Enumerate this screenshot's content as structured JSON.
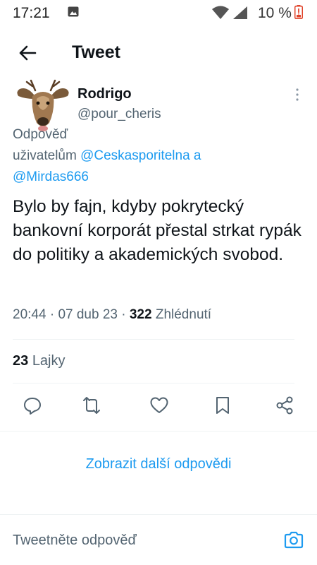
{
  "status_bar": {
    "time": "17:21",
    "battery": "10 %",
    "icons": [
      "image-icon",
      "wifi-icon",
      "cellular-icon",
      "battery-low-icon"
    ]
  },
  "header": {
    "back_icon": "arrow-left-icon",
    "title": "Tweet"
  },
  "tweet": {
    "author_name": "Rodrigo",
    "author_handle": "@pour_cheris",
    "reply_prefix": "Odpověď",
    "reply_to_label": "uživatelům",
    "mentions": [
      "@Ceskasporitelna",
      "@Mirdas666"
    ],
    "mention_joiner": "a",
    "text": "Bylo by fajn, kdyby pokrytecký bankovní korporát přestal strkat rypák do politiky a akademických svobod.",
    "time": "20:44",
    "date": "07 dub 23",
    "views": "322",
    "views_label": "Zhlédnutí",
    "likes": "23",
    "likes_label": "Lajky"
  },
  "actions": [
    "reply-icon",
    "retweet-icon",
    "like-icon",
    "bookmark-icon",
    "share-icon"
  ],
  "more_replies_label": "Zobrazit další odpovědi",
  "reply_bar": {
    "placeholder": "Tweetněte odpověď",
    "icon": "camera-icon"
  },
  "colors": {
    "accent": "#1d9bf0",
    "text": "#0f1419",
    "secondary": "#536471",
    "divider": "#eff3f4"
  }
}
